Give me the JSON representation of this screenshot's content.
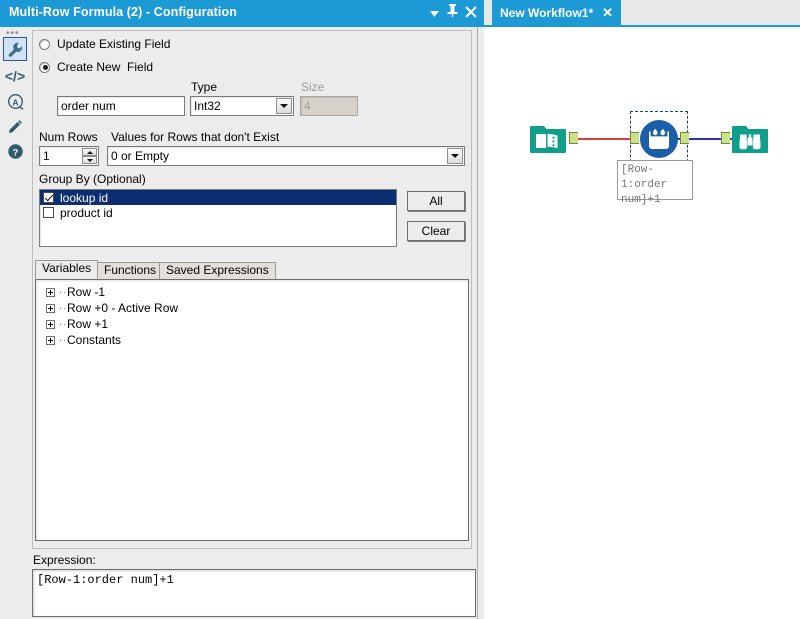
{
  "config_panel": {
    "title": "Multi-Row Formula (2) - Configuration",
    "titlebar_buttons": [
      {
        "name": "dropdown-icon",
        "glyph": "▾"
      },
      {
        "name": "pin-icon",
        "glyph": "▬"
      },
      {
        "name": "close-icon",
        "glyph": "✕"
      }
    ],
    "rail_icons": [
      {
        "name": "wrench-icon",
        "label": "Configuration"
      },
      {
        "name": "code-icon",
        "label": "XML"
      },
      {
        "name": "annotation-icon",
        "label": "Annotation"
      },
      {
        "name": "ruler-icon",
        "label": "Tool Options"
      },
      {
        "name": "help-icon",
        "label": "Help"
      }
    ],
    "field_mode": {
      "update_existing_label": "Update Existing Field",
      "create_new_label": "Create New  Field",
      "selected": "create_new"
    },
    "field_name": {
      "value": "order num"
    },
    "type": {
      "label": "Type",
      "value": "Int32"
    },
    "size": {
      "label": "Size",
      "value": "4",
      "disabled": true
    },
    "num_rows": {
      "label": "Num Rows",
      "value": "1"
    },
    "values_for_rows": {
      "label": "Values for Rows that don't Exist",
      "value": "0 or Empty"
    },
    "group_by": {
      "label": "Group By (Optional)",
      "items": [
        {
          "label": "lookup id",
          "checked": true,
          "selected": true
        },
        {
          "label": "product id",
          "checked": false,
          "selected": false
        }
      ],
      "all_button": "All",
      "clear_button": "Clear"
    },
    "tabs": [
      {
        "label": "Variables",
        "active": true
      },
      {
        "label": "Functions",
        "active": false
      },
      {
        "label": "Saved Expressions",
        "active": false
      }
    ],
    "variables_tree": [
      {
        "label": "Row -1"
      },
      {
        "label": "Row +0 - Active Row"
      },
      {
        "label": "Row +1"
      },
      {
        "label": "Constants"
      }
    ],
    "expression": {
      "label": "Expression:",
      "value": "[Row-1:order num]+1"
    }
  },
  "canvas": {
    "tab": {
      "label": "New Workflow1*",
      "close_glyph": "✕"
    },
    "nodes": [
      {
        "name": "input-data-tool",
        "icon": "book-icon",
        "color": "#0e9e8a"
      },
      {
        "name": "multi-row-formula-tool",
        "icon": "beaker-droplets-icon",
        "color": "#1b5fa8",
        "selected": true
      },
      {
        "name": "browse-tool",
        "icon": "binoculars-icon",
        "color": "#0e9e8a"
      }
    ],
    "connections": [
      {
        "name": "input-to-formula-wire",
        "color": "#d93a3a"
      },
      {
        "name": "formula-to-browse-wire",
        "color": "#3030c0"
      }
    ],
    "node_label": "[Row-1:order num]+1"
  },
  "colors": {
    "accent": "#1c9ad6",
    "panel_bg": "#ececec",
    "selection": "#0c2d70",
    "teal": "#0e9e8a",
    "tool_blue": "#1b5fa8"
  }
}
